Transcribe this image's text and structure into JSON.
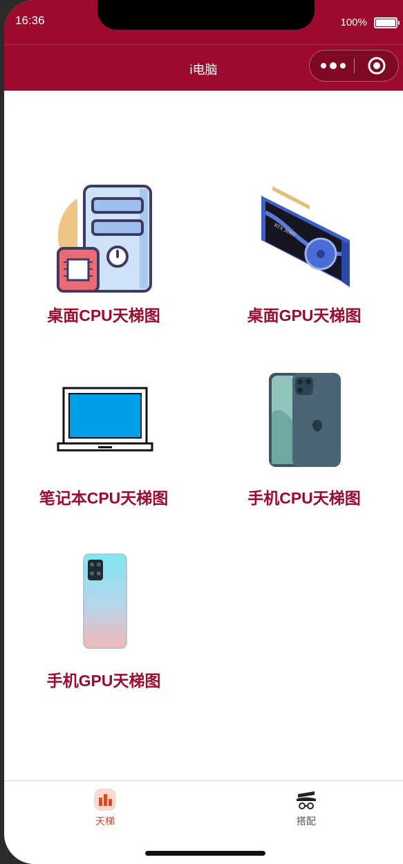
{
  "status": {
    "time": "16:36",
    "battery": "100%"
  },
  "nav": {
    "title": "i电脑"
  },
  "items": [
    {
      "label": "桌面CPU天梯图",
      "icon": "desktop-cpu-icon"
    },
    {
      "label": "桌面GPU天梯图",
      "icon": "gpu-card-icon"
    },
    {
      "label": "笔记本CPU天梯图",
      "icon": "laptop-icon"
    },
    {
      "label": "手机CPU天梯图",
      "icon": "iphone-icon"
    },
    {
      "label": "手机GPU天梯图",
      "icon": "android-phone-icon"
    }
  ],
  "tabs": [
    {
      "label": "天梯",
      "icon": "ladder-chart-icon",
      "active": true
    },
    {
      "label": "搭配",
      "icon": "hat-glasses-icon",
      "active": false
    }
  ],
  "colors": {
    "brand": "#9c0a2e",
    "active_tab": "#d9431e"
  }
}
